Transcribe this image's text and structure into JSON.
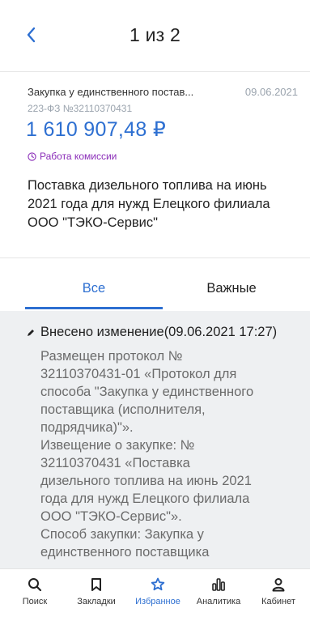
{
  "header": {
    "title": "1 из 2"
  },
  "purchase": {
    "type": "Закупка у единственного постав...",
    "date": "09.06.2021",
    "law": "223-ФЗ №32110370431",
    "price": "1 610 907,48 ₽",
    "status": "Работа комиссии",
    "description": "Поставка дизельного топлива на июнь 2021 года для нужд Елецкого филиала ООО \"ТЭКО-Сервис\""
  },
  "tabs": {
    "all": "Все",
    "important": "Важные"
  },
  "event": {
    "title": "Внесено изменение(09.06.2021 17:27)",
    "body": "Размещен протокол №\n32110370431-01 «Протокол для\nспособа \"Закупка у единственного\nпоставщика (исполнителя,\nподрядчика)\"».\nИзвещение о закупке: №\n32110370431 «Поставка\nдизельного топлива на июнь 2021\nгода для нужд Елецкого филиала\nООО \"ТЭКО-Сервис\"».\nСпособ закупки: Закупка у\nединственного поставщика"
  },
  "bottom_nav": {
    "search": "Поиск",
    "bookmarks": "Закладки",
    "favorites": "Избранное",
    "analytics": "Аналитика",
    "cabinet": "Кабинет"
  },
  "colors": {
    "accent": "#2d6fd1",
    "status": "#8a2cb8",
    "muted": "#9aa3ad"
  }
}
